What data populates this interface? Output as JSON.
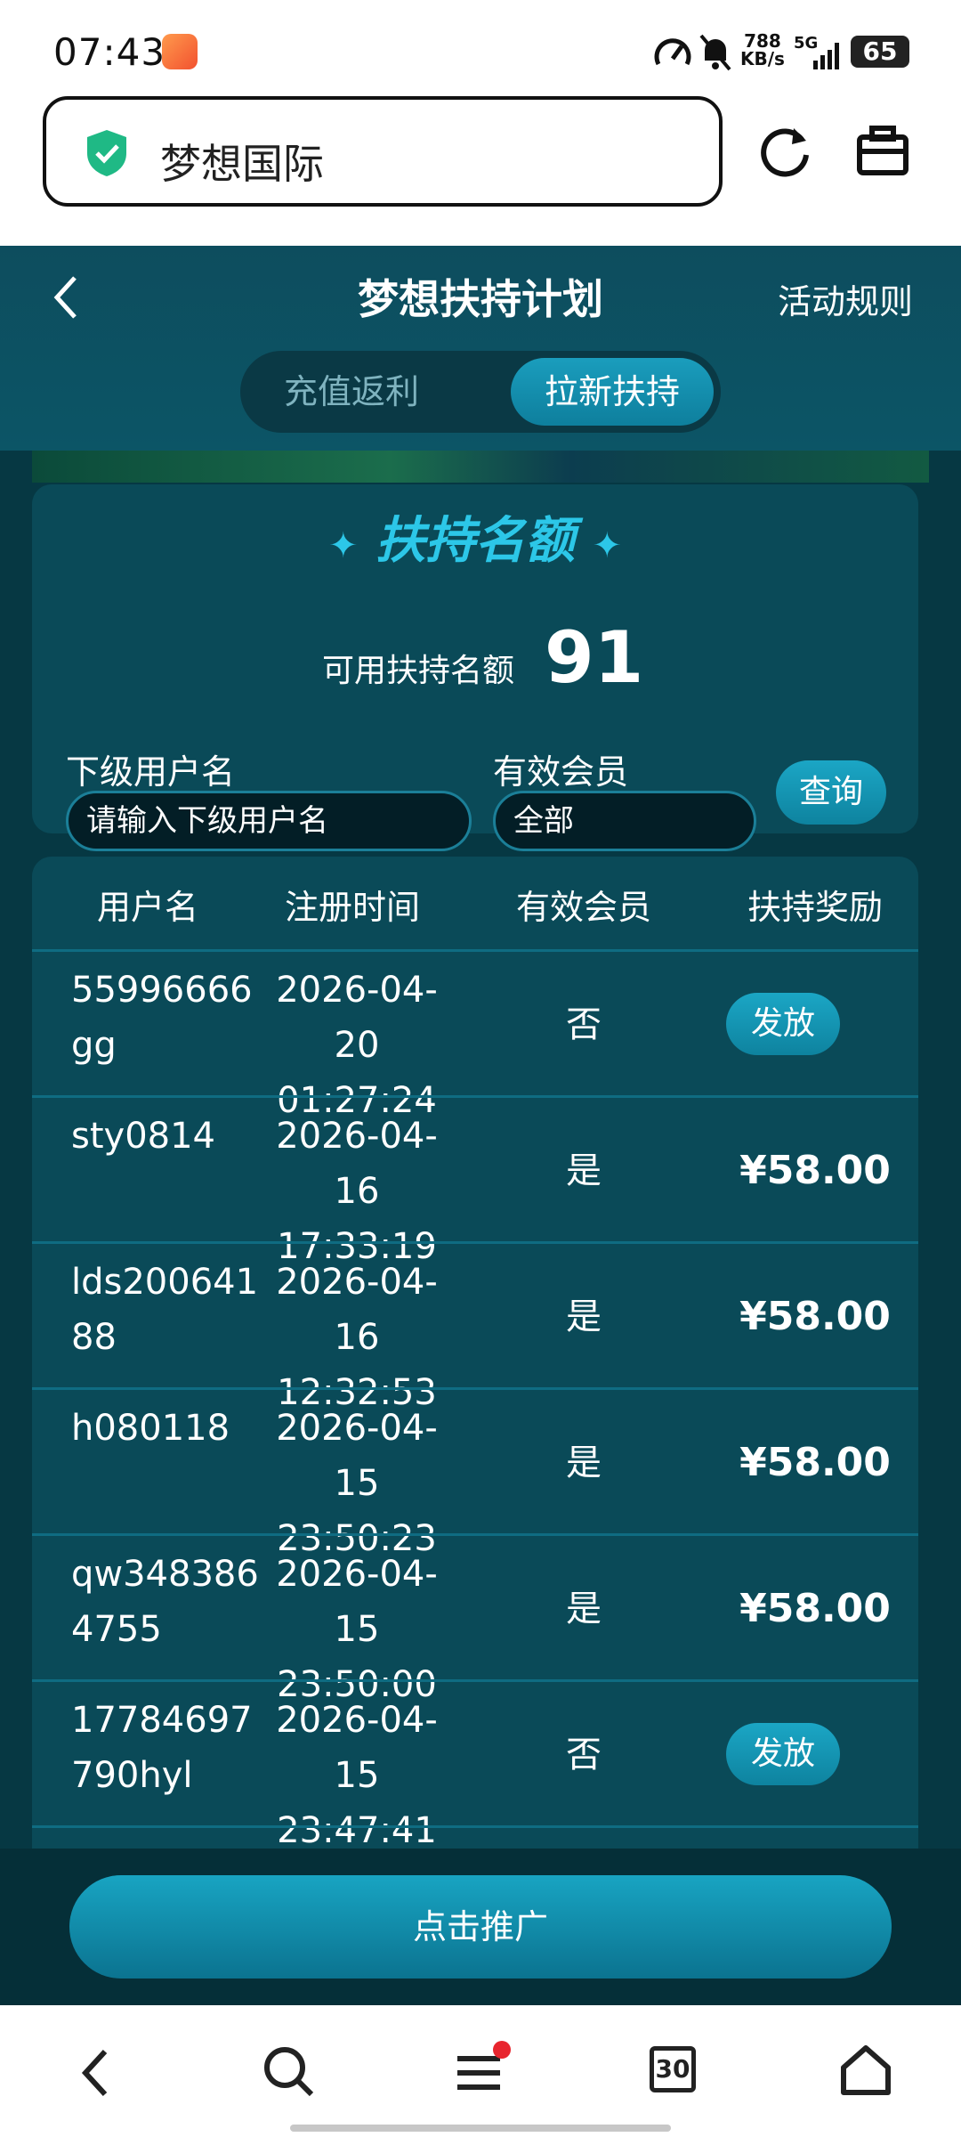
{
  "status": {
    "time": "07:43",
    "net_speed_top": "788",
    "net_speed_bottom": "KB/s",
    "network": "5G",
    "battery": "65"
  },
  "browser": {
    "site_name": "梦想国际"
  },
  "header": {
    "title": "梦想扶持计划",
    "rules": "活动规则",
    "tabs": [
      {
        "label": "充值返利",
        "active": false
      },
      {
        "label": "拉新扶持",
        "active": true
      }
    ]
  },
  "quota": {
    "heading": "扶持名额",
    "available_label": "可用扶持名额",
    "available_value": "91"
  },
  "filters": {
    "username_label": "下级用户名",
    "username_placeholder": "请输入下级用户名",
    "member_label": "有效会员",
    "member_value": "全部",
    "query_button": "查询"
  },
  "table": {
    "headers": [
      "用户名",
      "注册时间",
      "有效会员",
      "扶持奖励"
    ],
    "rows": [
      {
        "username": "55996666gg",
        "time": "2026-04-20 01:27:24",
        "member": "否",
        "reward": "发放",
        "is_button": true
      },
      {
        "username": "sty0814",
        "time": "2026-04-16 17:33:19",
        "member": "是",
        "reward": "¥58.00",
        "is_button": false
      },
      {
        "username": "lds20064188",
        "time": "2026-04-16 12:32:53",
        "member": "是",
        "reward": "¥58.00",
        "is_button": false
      },
      {
        "username": "h080118",
        "time": "2026-04-15 23:50:23",
        "member": "是",
        "reward": "¥58.00",
        "is_button": false
      },
      {
        "username": "qw3483864755",
        "time": "2026-04-15 23:50:00",
        "member": "是",
        "reward": "¥58.00",
        "is_button": false
      },
      {
        "username": "17784697790hyl",
        "time": "2026-04-15 23:47:41",
        "member": "否",
        "reward": "发放",
        "is_button": true
      }
    ]
  },
  "promo_button": "点击推广",
  "nav": {
    "tabs_count": "30"
  },
  "colors": {
    "accent": "#1ba6c5",
    "panel": "#0a4a58",
    "background": "#063843",
    "header": "#0c5566"
  }
}
